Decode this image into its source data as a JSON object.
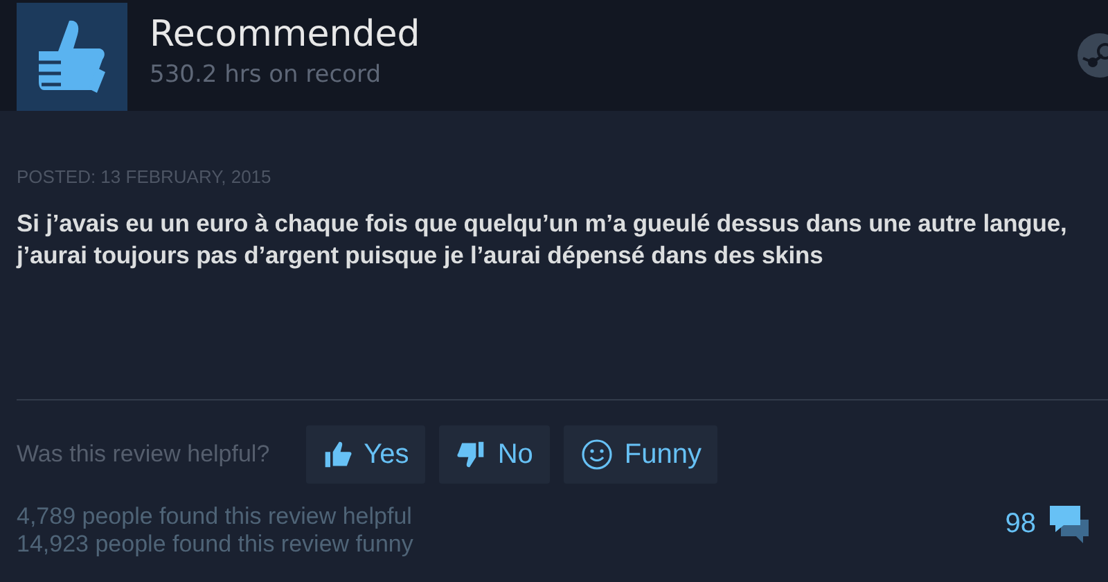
{
  "header": {
    "title": "Recommended",
    "hours": "530.2 hrs on record"
  },
  "posted": "POSTED: 13 FEBRUARY, 2015",
  "review": "Si j’avais eu un euro à chaque fois que quelqu’un m’a gueulé dessus dans une autre langue, j’aurai toujours pas d’argent puisque je l’aurai dépensé dans des skins",
  "helpful_prompt": "Was this review helpful?",
  "buttons": [
    {
      "label": "Yes",
      "kind": "up"
    },
    {
      "label": "No",
      "kind": "down"
    },
    {
      "label": "Funny",
      "kind": "funny"
    }
  ],
  "stats": [
    "4,789 people found this review helpful",
    "14,923 people found this review funny"
  ],
  "comment_count": "98"
}
